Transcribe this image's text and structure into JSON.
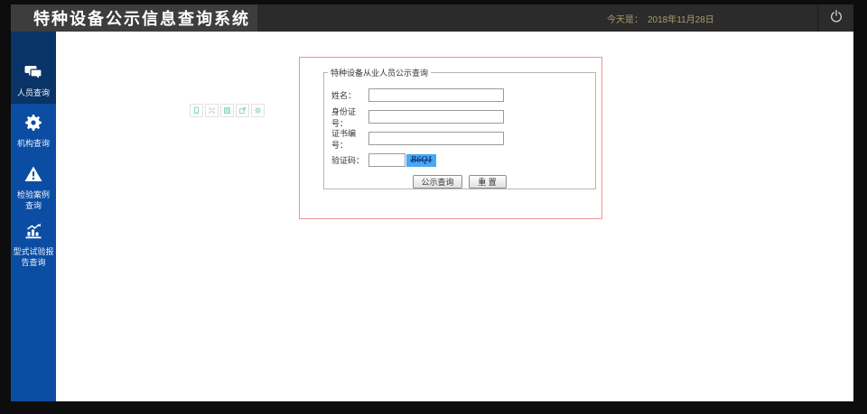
{
  "header": {
    "title": "特种设备公示信息查询系统",
    "date_label": "今天是：",
    "date_value": "2018年11月28日"
  },
  "sidebar": {
    "items": [
      {
        "line1": "人员查询",
        "line2": "",
        "icon": "chat-bubbles",
        "active": true
      },
      {
        "line1": "机构查询",
        "line2": "",
        "icon": "gear",
        "active": false
      },
      {
        "line1": "检验案例",
        "line2": "查询",
        "icon": "warning-triangle",
        "active": false
      },
      {
        "line1": "型式试验报",
        "line2": "告查询",
        "icon": "bar-chart",
        "active": false
      }
    ]
  },
  "mini_toolbar": {
    "icons": [
      "mobile",
      "expand",
      "save",
      "external-link",
      "settings"
    ]
  },
  "form": {
    "legend": "特种设备从业人员公示查询",
    "name_label": "姓名：",
    "name_value": "",
    "id_label": "身份证号：",
    "id_value": "",
    "cert_label": "证书编号：",
    "cert_value": "",
    "captcha_label": "验证码：",
    "captcha_value": "",
    "captcha_code": "B6Q1",
    "query_button": "公示查询",
    "reset_button": "重 置"
  },
  "colors": {
    "sidebar_blue": "#0b4da3",
    "sidebar_active_navy": "#093467",
    "panel_border_red": "#f19191",
    "captcha_blue": "#47a8f3",
    "mint_icon": "#7fd7ae",
    "header_gray": "#3d3d3d",
    "topbar_gray": "#2b2b2b"
  }
}
